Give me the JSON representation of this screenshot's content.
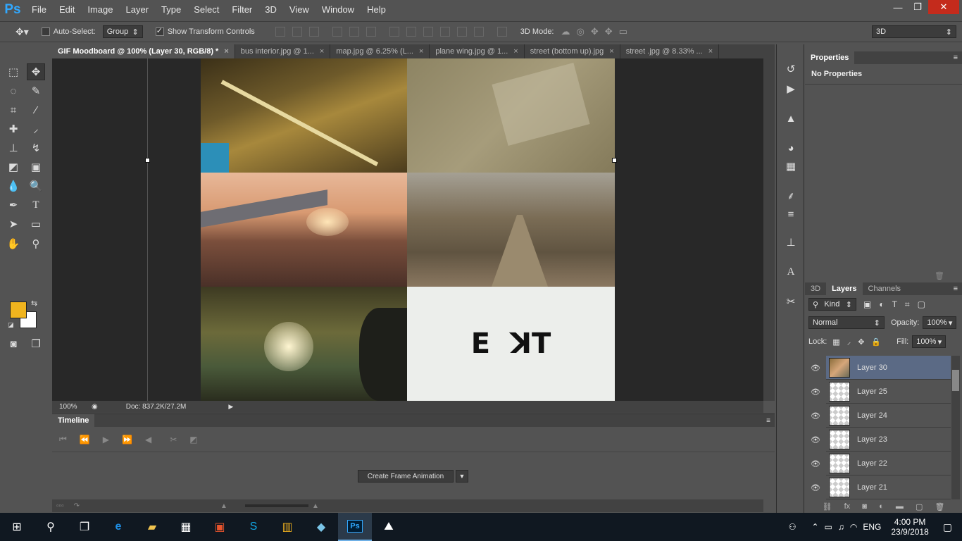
{
  "app": {
    "logo": "Ps"
  },
  "menu": [
    "File",
    "Edit",
    "Image",
    "Layer",
    "Type",
    "Select",
    "Filter",
    "3D",
    "View",
    "Window",
    "Help"
  ],
  "window_controls": {
    "minimize": "—",
    "restore": "❐",
    "close": "✕"
  },
  "options_bar": {
    "auto_select_label": "Auto-Select:",
    "auto_select_checked": false,
    "group_value": "Group",
    "show_transform_label": "Show Transform Controls",
    "show_transform_checked": true,
    "mode_3d_label": "3D Mode:",
    "workspace_value": "3D"
  },
  "tabs": [
    {
      "label": "GIF Moodboard @ 100% (Layer 30, RGB/8) *",
      "active": true
    },
    {
      "label": "bus interior.jpg @ 1...",
      "active": false
    },
    {
      "label": "map.jpg @ 6.25% (L...",
      "active": false
    },
    {
      "label": "plane wing.jpg @ 1...",
      "active": false
    },
    {
      "label": "street (bottom up).jpg",
      "active": false
    },
    {
      "label": "street .jpg @ 8.33% ...",
      "active": false
    }
  ],
  "canvas": {
    "logo_text": "E  ꓘT"
  },
  "status": {
    "zoom": "100%",
    "doc": "Doc: 837.2K/27.2M"
  },
  "colors": {
    "foreground": "#f0b41e",
    "background": "#ffffff",
    "accent": "#31a8ff"
  },
  "timeline": {
    "tab": "Timeline",
    "create_button": "Create Frame Animation"
  },
  "properties": {
    "tab": "Properties",
    "content": "No Properties"
  },
  "layers_panel": {
    "tabs": [
      "3D",
      "Layers",
      "Channels"
    ],
    "active_tab": "Layers",
    "filter_kind": "Kind",
    "blend_mode": "Normal",
    "opacity_label": "Opacity:",
    "opacity_value": "100%",
    "lock_label": "Lock:",
    "fill_label": "Fill:",
    "fill_value": "100%",
    "layers": [
      {
        "name": "Layer 30",
        "selected": true
      },
      {
        "name": "Layer 25",
        "selected": false
      },
      {
        "name": "Layer 24",
        "selected": false
      },
      {
        "name": "Layer 23",
        "selected": false
      },
      {
        "name": "Layer 22",
        "selected": false
      },
      {
        "name": "Layer 21",
        "selected": false
      }
    ]
  },
  "taskbar": {
    "language": "ENG",
    "time": "4:00 PM",
    "date": "23/9/2018"
  }
}
